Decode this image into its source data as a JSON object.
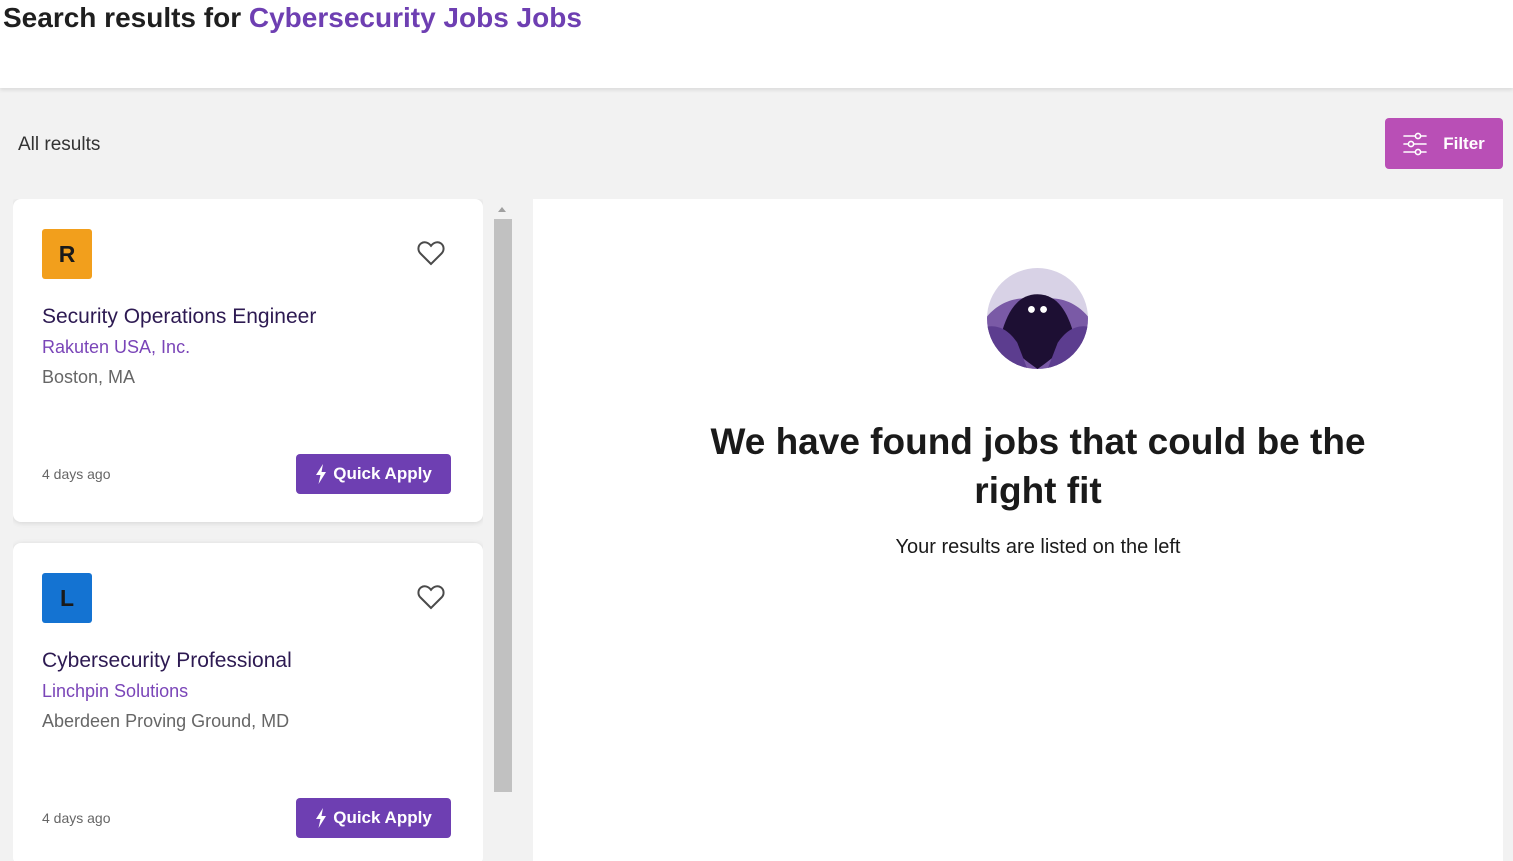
{
  "header": {
    "title_prefix": "Search results for",
    "title_query": "Cybersecurity Jobs Jobs"
  },
  "toolbar": {
    "results_label": "All results",
    "filter_label": "Filter",
    "filter_icon": "sliders-icon"
  },
  "jobs": [
    {
      "logo_letter": "R",
      "logo_color": "#f29f1c",
      "title": "Security Operations Engineer",
      "company": "Rakuten USA, Inc.",
      "location": "Boston, MA",
      "posted": "4 days ago",
      "apply_label": "Quick Apply"
    },
    {
      "logo_letter": "L",
      "logo_color": "#1473d2",
      "title": "Cybersecurity Professional",
      "company": "Linchpin Solutions",
      "location": "Aberdeen Proving Ground, MD",
      "posted": "4 days ago",
      "apply_label": "Quick Apply"
    }
  ],
  "detail": {
    "heading": "We have found jobs that could be the right fit",
    "subtext": "Your results are listed on the left"
  },
  "colors": {
    "brand_purple": "#6e3fb2",
    "filter_magenta": "#b94fb6",
    "company_link": "#7a45b8"
  }
}
